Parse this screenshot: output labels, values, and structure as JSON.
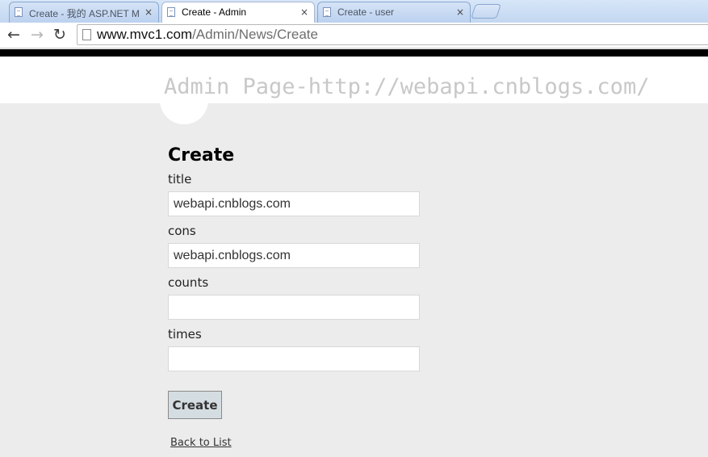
{
  "browser": {
    "tabs": [
      {
        "title": "Create - 我的 ASP.NET M",
        "active": false
      },
      {
        "title": "Create - Admin",
        "active": true
      },
      {
        "title": "Create - user",
        "active": false
      }
    ],
    "close_glyph": "×",
    "url": {
      "host": "www.mvc1.com",
      "path": "/Admin/News/Create"
    },
    "nav_icons": {
      "back": "back-arrow-icon",
      "forward": "forward-arrow-icon",
      "reload": "reload-icon"
    }
  },
  "header": {
    "site_title": "Admin Page-http://webapi.cnblogs.com/"
  },
  "form": {
    "heading": "Create",
    "fields": [
      {
        "label": "title",
        "value": "webapi.cnblogs.com"
      },
      {
        "label": "cons",
        "value": "webapi.cnblogs.com"
      },
      {
        "label": "counts",
        "value": ""
      },
      {
        "label": "times",
        "value": ""
      }
    ],
    "submit_label": "Create",
    "back_link": "Back to List"
  },
  "colors": {
    "page_background": "#ececec",
    "header_text": "#c8c8c8",
    "button_background": "#d4dde2"
  }
}
